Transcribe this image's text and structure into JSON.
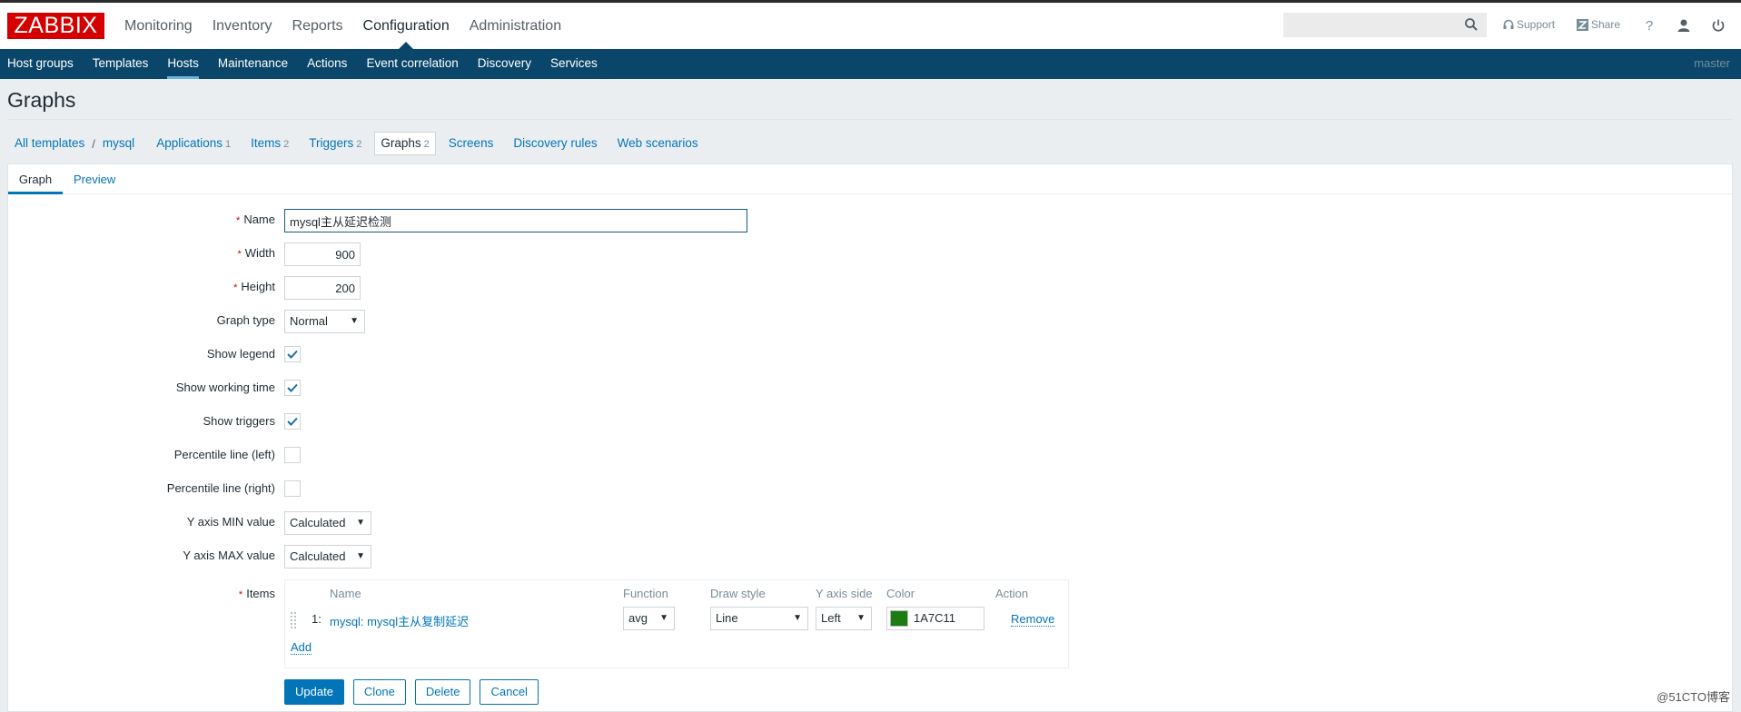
{
  "header": {
    "logo": "ZABBIX",
    "top_nav": [
      {
        "label": "Monitoring",
        "active": false
      },
      {
        "label": "Inventory",
        "active": false
      },
      {
        "label": "Reports",
        "active": false
      },
      {
        "label": "Configuration",
        "active": true
      },
      {
        "label": "Administration",
        "active": false
      }
    ],
    "search": {
      "value": "",
      "placeholder": "",
      "icon": "search-icon"
    },
    "support_label": "Support",
    "share_label": "Share",
    "help_label": "?",
    "user_icon": "user-icon",
    "logout_icon": "power-icon"
  },
  "sub_nav": {
    "items": [
      {
        "label": "Host groups",
        "active": false
      },
      {
        "label": "Templates",
        "active": false
      },
      {
        "label": "Hosts",
        "active": true
      },
      {
        "label": "Maintenance",
        "active": false
      },
      {
        "label": "Actions",
        "active": false
      },
      {
        "label": "Event correlation",
        "active": false
      },
      {
        "label": "Discovery",
        "active": false
      },
      {
        "label": "Services",
        "active": false
      }
    ],
    "server_name": "master"
  },
  "page": {
    "title": "Graphs",
    "breadcrumbs": {
      "all_templates": "All templates",
      "separator": "/",
      "template": "mysql",
      "links": [
        {
          "label": "Applications",
          "count": "1"
        },
        {
          "label": "Items",
          "count": "2"
        },
        {
          "label": "Triggers",
          "count": "2"
        },
        {
          "label": "Graphs",
          "count": "2",
          "selected": true
        },
        {
          "label": "Screens",
          "count": ""
        },
        {
          "label": "Discovery rules",
          "count": ""
        },
        {
          "label": "Web scenarios",
          "count": ""
        }
      ]
    },
    "tabs": [
      {
        "label": "Graph",
        "active": true
      },
      {
        "label": "Preview",
        "active": false
      }
    ]
  },
  "form": {
    "required_mark": "*",
    "name": {
      "label": "Name",
      "value": "mysql主从延迟检测"
    },
    "width": {
      "label": "Width",
      "value": "900"
    },
    "height": {
      "label": "Height",
      "value": "200"
    },
    "graph_type": {
      "label": "Graph type",
      "value": "Normal"
    },
    "show_legend": {
      "label": "Show legend",
      "checked": true
    },
    "show_working_time": {
      "label": "Show working time",
      "checked": true
    },
    "show_triggers": {
      "label": "Show triggers",
      "checked": true
    },
    "percentile_left": {
      "label": "Percentile line (left)",
      "checked": false
    },
    "percentile_right": {
      "label": "Percentile line (right)",
      "checked": false
    },
    "y_min": {
      "label": "Y axis MIN value",
      "value": "Calculated"
    },
    "y_max": {
      "label": "Y axis MAX value",
      "value": "Calculated"
    },
    "items": {
      "label": "Items",
      "columns": {
        "name": "Name",
        "function": "Function",
        "draw_style": "Draw style",
        "y_axis_side": "Y axis side",
        "color": "Color",
        "action": "Action"
      },
      "rows": [
        {
          "index": "1:",
          "name": "mysql: mysql主从复制延迟",
          "function": "avg",
          "draw_style": "Line",
          "y_axis_side": "Left",
          "color": "1A7C11",
          "color_hex": "#1A7C11",
          "action": "Remove"
        }
      ],
      "add_label": "Add"
    },
    "buttons": {
      "update": "Update",
      "clone": "Clone",
      "delete": "Delete",
      "cancel": "Cancel"
    }
  },
  "watermark": "@51CTO博客",
  "colors": {
    "brand_red": "#d40000",
    "nav_blue": "#0a466a",
    "link_blue": "#0275b8",
    "item_color": "#1A7C11"
  }
}
